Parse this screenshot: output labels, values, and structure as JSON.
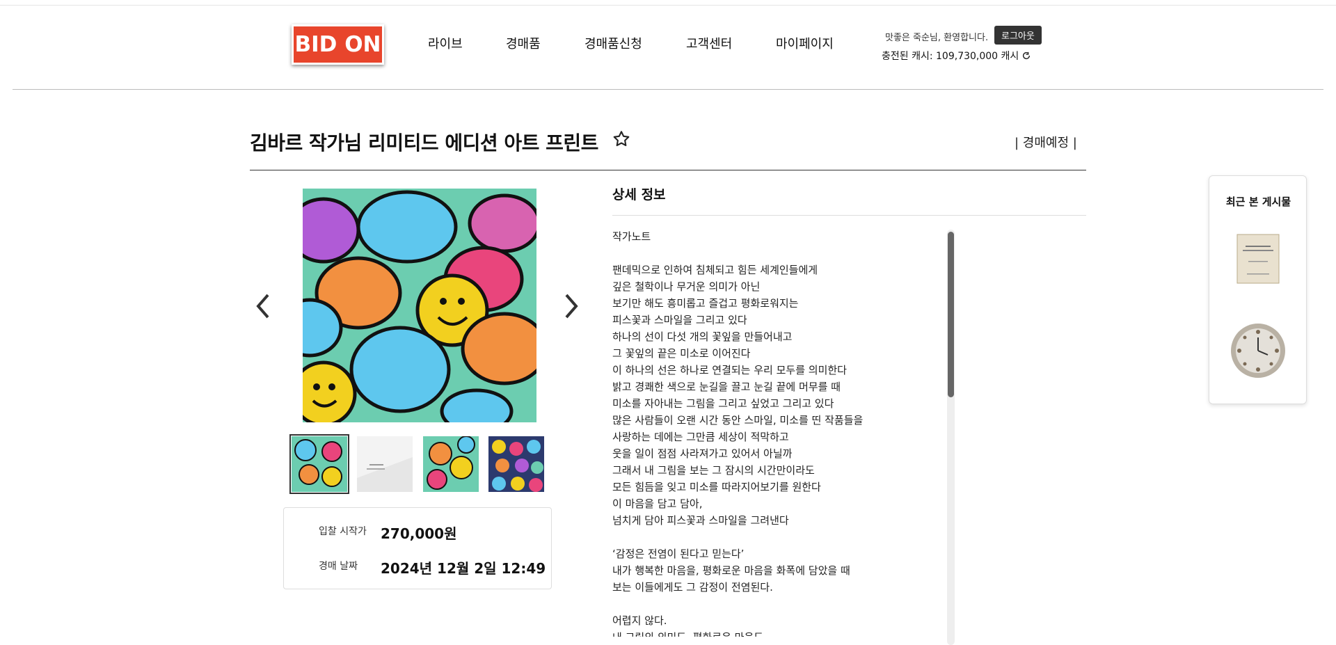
{
  "header": {
    "logo_text": "BID ON",
    "nav": [
      "라이브",
      "경매품",
      "경매품신청",
      "고객센터",
      "마이페이지"
    ],
    "welcome": "맛좋은 죽순님, 환영합니다.",
    "logout_label": "로그아웃",
    "cash_label": "충전된 캐시: 109,730,000 캐시"
  },
  "item": {
    "title": "김바르 작가님 리미티드 에디션 아트 프린트",
    "status": "| 경매예정 |",
    "start_price_label": "입찰 시작가",
    "start_price": "270,000원",
    "date_label": "경매 날짜",
    "date": "2024년 12월 2일 12:49"
  },
  "detail": {
    "heading": "상세 정보",
    "body": "작가노트\n\n팬데믹으로 인하여 침체되고 힘든 세계인들에게\n깊은 철학이나 무거운 의미가 아닌\n보기만 해도 흥미롭고 즐겁고 평화로워지는\n피스꽃과 스마일을 그리고 있다\n하나의 선이 다섯 개의 꽃잎을 만들어내고\n그 꽃잎의 끝은 미소로 이어진다\n이 하나의 선은 하나로 연결되는 우리 모두를 의미한다\n밝고 경쾌한 색으로 눈길을 끌고 눈길 끝에 머무를 때\n미소를 자아내는 그림을 그리고 싶었고 그리고 있다\n많은 사람들이 오랜 시간 동안 스마일, 미소를 띤 작품들을\n사랑하는 데에는 그만큼 세상이 적막하고\n웃을 일이 점점 사라져가고 있어서 아닐까\n그래서 내 그림을 보는 그 잠시의 시간만이라도\n모든 힘듬을 잊고 미소를 따라지어보기를 원한다\n이 마음을 담고 담아,\n넘치게 담아 피스꽃과 스마일을 그려낸다\n\n‘감정은 전염이 된다고 믿는다’\n내가 행복한 마음을, 평화로운 마음을 화폭에 담았을 때\n보는 이들에게도 그 감정이 전염된다.\n\n어렵지 않다.\n내 그림의 의미도, 평화로운 마음도"
  },
  "recent": {
    "title": "최근 본 게시물"
  },
  "colors": {
    "logo_red": "#e8452c",
    "dark_button": "#333333"
  }
}
